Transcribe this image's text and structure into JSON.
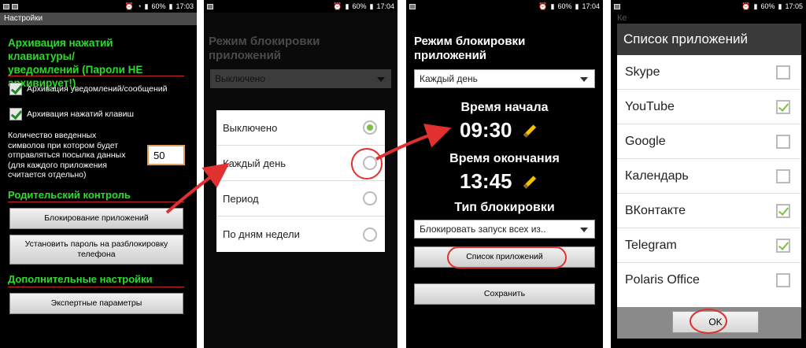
{
  "status": {
    "p1": {
      "battery": "60%",
      "time": "17:03"
    },
    "p2": {
      "battery": "60%",
      "time": "17:04"
    },
    "p3": {
      "battery": "60%",
      "time": "17:04"
    },
    "p4": {
      "battery": "60%",
      "time": "17:05"
    }
  },
  "settings": {
    "title": "Настройки",
    "archive_header_l1": "Архивация нажатий клавиатуры/",
    "archive_header_l2": "уведомлений (Пароли НЕ",
    "archive_header_l3": "архивирует!)",
    "chk_notifications": "Архивация уведомлений/сообщений",
    "chk_keys": "Архивация нажатий клавиш",
    "count_l1": "Количество введенных",
    "count_l2": "символов при котором будет",
    "count_l3": "отправляться посылка данных",
    "count_l4": "(для каждого приложения",
    "count_l5": "считается отдельно)",
    "count_value": "50",
    "parental_header": "Родительский контроль",
    "btn_block_apps": "Блокирование приложений",
    "btn_set_password_l1": "Установить пароль на разблокировку",
    "btn_set_password_l2": "телефона",
    "extra_header": "Дополнительные настройки",
    "btn_expert": "Экспертные параметры"
  },
  "mode_dialog": {
    "header_l1": "Режим блокировки",
    "header_l2": "приложений",
    "dropdown_value": "Выключено",
    "options": [
      "Выключено",
      "Каждый день",
      "Период",
      "По дням недели"
    ],
    "selected_index": 0
  },
  "schedule": {
    "header_l1": "Режим блокировки",
    "header_l2": "приложений",
    "mode_value": "Каждый день",
    "start_label": "Время начала",
    "start_time": "09:30",
    "end_label": "Время окончания",
    "end_time": "13:45",
    "block_type_label": "Тип блокировки",
    "block_type_value": "Блокировать запуск всех из..",
    "btn_app_list": "Список приложений",
    "btn_save": "Сохранить"
  },
  "app_list": {
    "behind_title": "Ке",
    "title": "Список приложений",
    "apps": [
      {
        "name": "Skype",
        "checked": false
      },
      {
        "name": "YouTube",
        "checked": true
      },
      {
        "name": "Google",
        "checked": false
      },
      {
        "name": "Календарь",
        "checked": false
      },
      {
        "name": "ВКонтакте",
        "checked": true
      },
      {
        "name": "Telegram",
        "checked": true
      },
      {
        "name": "Polaris Office",
        "checked": false
      }
    ],
    "ok_label": "OK"
  },
  "colors": {
    "accent_green": "#2bdc2b",
    "annotation_red": "#e03030",
    "check_green": "#7bc043"
  }
}
